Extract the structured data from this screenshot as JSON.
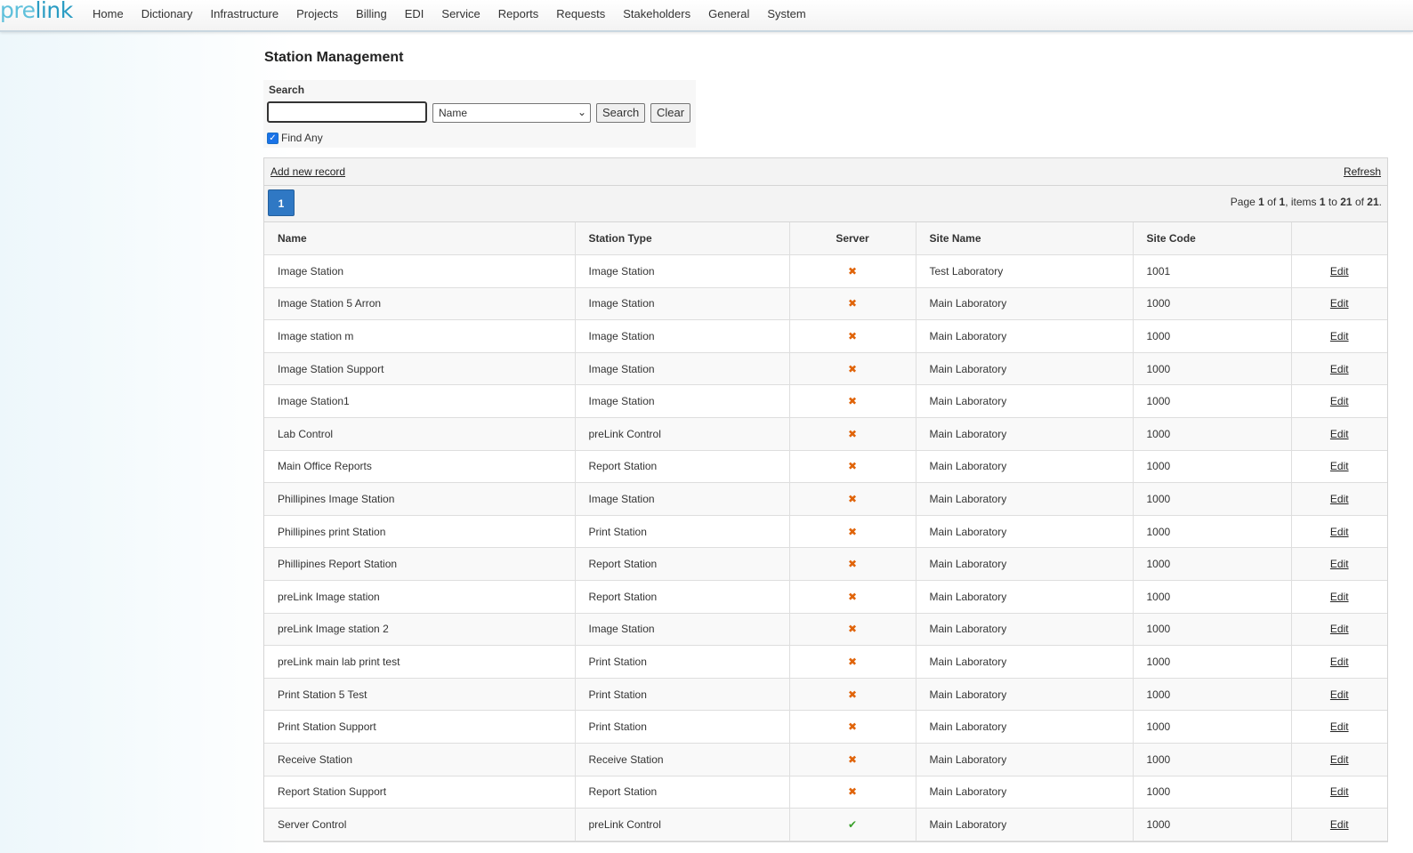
{
  "app": {
    "logo_part1": "pre",
    "logo_part2": "link"
  },
  "nav": [
    "Home",
    "Dictionary",
    "Infrastructure",
    "Projects",
    "Billing",
    "EDI",
    "Service",
    "Reports",
    "Requests",
    "Stakeholders",
    "General",
    "System"
  ],
  "page": {
    "title": "Station Management"
  },
  "search": {
    "label": "Search",
    "input_value": "",
    "field_selected": "Name",
    "search_button": "Search",
    "clear_button": "Clear",
    "find_any_label": "Find Any",
    "find_any_checked": true
  },
  "grid": {
    "add_label": "Add new record",
    "refresh_label": "Refresh",
    "current_page": "1",
    "pager_info": {
      "prefix": "Page ",
      "page": "1",
      "of": " of ",
      "pages": "1",
      "items": ", items ",
      "from": "1",
      "to": " to ",
      "to_val": "21",
      "of2": " of ",
      "total": "21",
      "end": "."
    },
    "columns": [
      "Name",
      "Station Type",
      "Server",
      "Site Name",
      "Site Code",
      ""
    ],
    "edit_label": "Edit",
    "rows": [
      {
        "name": "Image Station",
        "type": "Image Station",
        "server": false,
        "site": "Test Laboratory",
        "code": "1001"
      },
      {
        "name": "Image Station 5 Arron",
        "type": "Image Station",
        "server": false,
        "site": "Main Laboratory",
        "code": "1000"
      },
      {
        "name": "Image station m",
        "type": "Image Station",
        "server": false,
        "site": "Main Laboratory",
        "code": "1000"
      },
      {
        "name": "Image Station Support",
        "type": "Image Station",
        "server": false,
        "site": "Main Laboratory",
        "code": "1000"
      },
      {
        "name": "Image Station1",
        "type": "Image Station",
        "server": false,
        "site": "Main Laboratory",
        "code": "1000"
      },
      {
        "name": "Lab Control",
        "type": "preLink Control",
        "server": false,
        "site": "Main Laboratory",
        "code": "1000"
      },
      {
        "name": "Main Office Reports",
        "type": "Report Station",
        "server": false,
        "site": "Main Laboratory",
        "code": "1000"
      },
      {
        "name": "Phillipines Image Station",
        "type": "Image Station",
        "server": false,
        "site": "Main Laboratory",
        "code": "1000"
      },
      {
        "name": "Phillipines print Station",
        "type": "Print Station",
        "server": false,
        "site": "Main Laboratory",
        "code": "1000"
      },
      {
        "name": "Phillipines Report Station",
        "type": "Report Station",
        "server": false,
        "site": "Main Laboratory",
        "code": "1000"
      },
      {
        "name": "preLink Image station",
        "type": "Report Station",
        "server": false,
        "site": "Main Laboratory",
        "code": "1000"
      },
      {
        "name": "preLink Image station 2",
        "type": "Image Station",
        "server": false,
        "site": "Main Laboratory",
        "code": "1000"
      },
      {
        "name": "preLink main lab print test",
        "type": "Print Station",
        "server": false,
        "site": "Main Laboratory",
        "code": "1000"
      },
      {
        "name": "Print Station 5 Test",
        "type": "Print Station",
        "server": false,
        "site": "Main Laboratory",
        "code": "1000"
      },
      {
        "name": "Print Station Support",
        "type": "Print Station",
        "server": false,
        "site": "Main Laboratory",
        "code": "1000"
      },
      {
        "name": "Receive Station",
        "type": "Receive Station",
        "server": false,
        "site": "Main Laboratory",
        "code": "1000"
      },
      {
        "name": "Report Station Support",
        "type": "Report Station",
        "server": false,
        "site": "Main Laboratory",
        "code": "1000"
      },
      {
        "name": "Server Control",
        "type": "preLink Control",
        "server": true,
        "site": "Main Laboratory",
        "code": "1000"
      }
    ]
  },
  "icons": {
    "server_false": "x-icon",
    "server_true": "check-icon"
  },
  "colors": {
    "accent": "#2f78c4",
    "x_icon": "#e0640a",
    "check_icon": "#3aa02b",
    "logo": "#5fc0db"
  }
}
